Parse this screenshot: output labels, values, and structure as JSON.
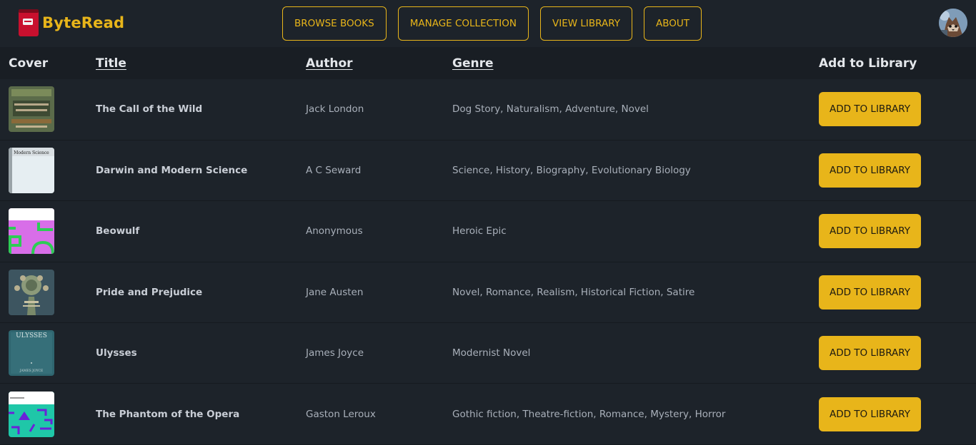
{
  "app": {
    "name": "ByteRead",
    "accent": "#e8b51a",
    "background": "#1d232a"
  },
  "nav": {
    "items": [
      {
        "label": "BROWSE BOOKS"
      },
      {
        "label": "MANAGE COLLECTION"
      },
      {
        "label": "VIEW LIBRARY"
      },
      {
        "label": "ABOUT"
      }
    ],
    "avatar_icon": "raccoon-avatar"
  },
  "table": {
    "headers": {
      "cover": "Cover",
      "title": "Title",
      "author": "Author",
      "genre": "Genre",
      "add": "Add to Library"
    },
    "rows": [
      {
        "title": "The Call of the Wild",
        "author": "Jack London",
        "genre": "Dog Story, Naturalism, Adventure, Novel",
        "button": "ADD TO LIBRARY",
        "cover_icon": "call-of-the-wild-cover"
      },
      {
        "title": "Darwin and Modern Science",
        "author": "A C Seward",
        "genre": "Science, History, Biography, Evolutionary Biology",
        "button": "ADD TO LIBRARY",
        "cover_icon": "darwin-cover",
        "cover_text": "Modern Science"
      },
      {
        "title": "Beowulf",
        "author": "Anonymous",
        "genre": "Heroic Epic",
        "button": "ADD TO LIBRARY",
        "cover_icon": "beowulf-cover"
      },
      {
        "title": "Pride and Prejudice",
        "author": "Jane Austen",
        "genre": "Novel, Romance, Realism, Historical Fiction, Satire",
        "button": "ADD TO LIBRARY",
        "cover_icon": "pride-and-prejudice-cover"
      },
      {
        "title": "Ulysses",
        "author": "James Joyce",
        "genre": "Modernist Novel",
        "button": "ADD TO LIBRARY",
        "cover_icon": "ulysses-cover",
        "cover_text": "ULYSSES",
        "cover_subtext": "JAMES JOYCE"
      },
      {
        "title": "The Phantom of the Opera",
        "author": "Gaston Leroux",
        "genre": "Gothic fiction, Theatre-fiction, Romance, Mystery, Horror",
        "button": "ADD TO LIBRARY",
        "cover_icon": "phantom-cover"
      }
    ]
  }
}
